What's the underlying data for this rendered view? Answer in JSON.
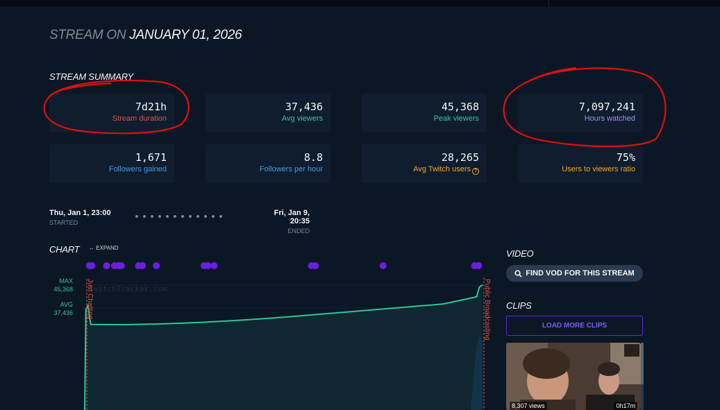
{
  "header": {
    "title_prefix": "STREAM ON",
    "title_date": "JANUARY 01, 2026"
  },
  "summary": {
    "heading": "STREAM SUMMARY",
    "cards": [
      {
        "value": "7d21h",
        "label": "Stream duration",
        "color": "#e2533d"
      },
      {
        "value": "37,436",
        "label": "Avg viewers",
        "color": "#3cc49a"
      },
      {
        "value": "45,368",
        "label": "Peak viewers",
        "color": "#3cc49a"
      },
      {
        "value": "7,097,241",
        "label": "Hours watched",
        "color": "#a78bfa"
      },
      {
        "value": "1,671",
        "label": "Followers gained",
        "color": "#4a9ce8"
      },
      {
        "value": "8.8",
        "label": "Followers per hour",
        "color": "#4a9ce8"
      },
      {
        "value": "28,265",
        "label": "Avg Twitch users",
        "color": "#f5a623",
        "icon": "question-circle-icon"
      },
      {
        "value": "75%",
        "label": "Users to viewers ratio",
        "color": "#f5a623"
      }
    ]
  },
  "timeline": {
    "start_time": "Thu, Jan 1, 23:00",
    "start_label": "STARTED",
    "end_time": "Fri, Jan 9, 20:35",
    "end_label": "ENDED"
  },
  "chart_section": {
    "heading": "CHART",
    "expand_label": "EXPAND",
    "expand_icon": "arrows-horizontal-icon",
    "watermark": "TwitchTracker.com",
    "max_label": "MAX",
    "max_value": "45,368",
    "avg_label": "AVG",
    "avg_value": "37,436",
    "category_start": "Just Chatting",
    "category_end": "Public Broadcasting"
  },
  "chart_data": {
    "type": "area",
    "x_range": [
      "2026-01-01 23:00",
      "2026-01-09 20:35"
    ],
    "ylim": [
      0,
      48000
    ],
    "series": [
      {
        "values": [
          0,
          36500,
          37800,
          31000,
          30900,
          31200,
          31800,
          32600,
          33600,
          34800,
          36000,
          37200,
          38400,
          41000,
          44500,
          45368
        ]
      }
    ],
    "secondary_series": [
      {
        "values": [
          0,
          0,
          0,
          0,
          0,
          0,
          0,
          0,
          0,
          0,
          0,
          0,
          0,
          23000,
          27000,
          25000
        ]
      }
    ],
    "marker_dots": [
      0.012,
      0.018,
      0.055,
      0.075,
      0.085,
      0.092,
      0.135,
      0.145,
      0.18,
      0.3,
      0.31,
      0.325,
      0.57,
      0.58,
      0.75,
      0.98,
      0.99
    ]
  },
  "video": {
    "heading": "VIDEO",
    "find_vod_label": "FIND VOD FOR THIS STREAM",
    "find_vod_icon": "search-icon"
  },
  "clips": {
    "heading": "CLIPS",
    "load_more_label": "LOAD MORE CLIPS",
    "items": [
      {
        "views": "8,307 views",
        "duration": "0h17m"
      }
    ]
  },
  "colors": {
    "background": "#0c1726",
    "card": "#101d2e",
    "line": "#2ec4a0",
    "marker": "#6c1fe0",
    "accent_red": "#e2533d"
  }
}
